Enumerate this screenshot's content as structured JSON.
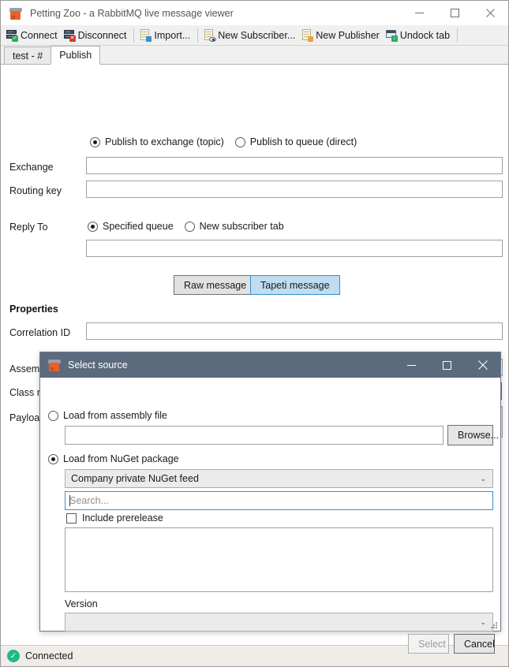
{
  "window": {
    "title": "Petting Zoo - a RabbitMQ live message viewer",
    "icon": "zoo-box-icon",
    "controls": [
      {
        "name": "minimize-button",
        "glyph": "minimize-icon"
      },
      {
        "name": "maximize-button",
        "glyph": "maximize-icon"
      },
      {
        "name": "close-button",
        "glyph": "close-icon"
      }
    ]
  },
  "toolbar": {
    "items": [
      {
        "label": "Connect",
        "icon": "server-connect-icon"
      },
      {
        "label": "Disconnect",
        "icon": "server-disconnect-icon"
      },
      {
        "sep": true
      },
      {
        "label": "Import...",
        "icon": "import-document-icon"
      },
      {
        "sep": true
      },
      {
        "label": "New Subscriber...",
        "icon": "new-subscriber-icon"
      },
      {
        "label": "New Publisher",
        "icon": "new-publisher-icon"
      },
      {
        "label": "Undock tab",
        "icon": "undock-tab-icon"
      },
      {
        "sep": true
      }
    ]
  },
  "tabs": [
    {
      "label": "test - #",
      "active": false
    },
    {
      "label": "Publish",
      "active": true
    }
  ],
  "publish": {
    "destination": {
      "exchange_option": "Publish to exchange (topic)",
      "queue_option": "Publish to queue (direct)",
      "selected": "exchange"
    },
    "exchange": {
      "label": "Exchange",
      "value": "",
      "placeholder": ""
    },
    "routing_key": {
      "label": "Routing key",
      "value": "",
      "placeholder": ""
    },
    "reply_to": {
      "label": "Reply To",
      "specified_queue_option": "Specified queue",
      "new_subscriber_option": "New subscriber tab",
      "selected": "specified",
      "value": "",
      "placeholder": ""
    },
    "message_type": {
      "raw_label": "Raw message",
      "tapeti_label": "Tapeti message",
      "selected": "tapeti"
    },
    "properties": {
      "title": "Properties",
      "correlation_id": {
        "label": "Correlation ID",
        "value": ""
      },
      "assembly_name": {
        "label": "Assembly name",
        "value": ""
      },
      "class_name": {
        "label": "Class name (full)",
        "value": "",
        "browse_label": "..."
      },
      "payload": {
        "label": "Payload",
        "value": ""
      }
    }
  },
  "statusbar": {
    "icon": "check-circle-icon",
    "text": "Connected",
    "color": "#1fb98a"
  },
  "dialog": {
    "title": "Select source",
    "icon": "zoo-box-icon",
    "controls": [
      {
        "name": "dialog-minimize-button",
        "glyph": "minimize-icon"
      },
      {
        "name": "dialog-maximize-button",
        "glyph": "maximize-icon"
      },
      {
        "name": "dialog-close-button",
        "glyph": "close-icon"
      }
    ],
    "assembly_source": {
      "radio_label": "Load from assembly file",
      "selected": false,
      "path_value": "",
      "browse_label": "Browse..."
    },
    "nuget_source": {
      "radio_label": "Load from NuGet package",
      "selected": true,
      "feed_value": "Company private NuGet feed",
      "search_value": "",
      "search_placeholder": "Search...",
      "include_prerelease_label": "Include prerelease",
      "include_prerelease_checked": false,
      "results": [],
      "version_label": "Version",
      "version_value": ""
    },
    "buttons": {
      "select_label": "Select",
      "select_enabled": false,
      "cancel_label": "Cancel",
      "cancel_enabled": true
    }
  }
}
